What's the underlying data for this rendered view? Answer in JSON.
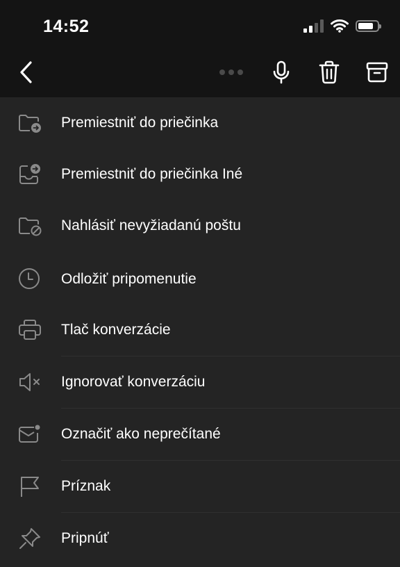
{
  "status_bar": {
    "time": "14:52"
  },
  "menu": {
    "items": [
      {
        "label": "Premiestniť do priečinka",
        "icon": "folder-move-icon"
      },
      {
        "label": "Premiestniť do priečinka Iné",
        "icon": "inbox-move-icon"
      },
      {
        "label": "Nahlásiť nevyžiadanú poštu",
        "icon": "folder-prohibited-icon"
      },
      {
        "label": "Odložiť pripomenutie",
        "icon": "clock-icon"
      },
      {
        "label": "Tlač konverzácie",
        "icon": "printer-icon"
      },
      {
        "label": "Ignorovať konverzáciu",
        "icon": "speaker-mute-icon"
      },
      {
        "label": "Označiť ako neprečítané",
        "icon": "mail-unread-icon"
      },
      {
        "label": "Príznak",
        "icon": "flag-icon"
      },
      {
        "label": "Pripnúť",
        "icon": "pin-icon"
      }
    ]
  },
  "colors": {
    "top_bar": "#141414",
    "sheet": "#242424",
    "icon": "#8a8a8a",
    "text": "#ffffff"
  }
}
